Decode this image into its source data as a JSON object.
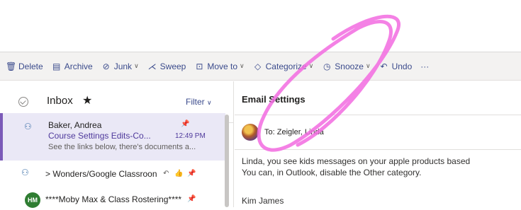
{
  "toolbar": {
    "delete": "Delete",
    "archive": "Archive",
    "junk": "Junk",
    "sweep": "Sweep",
    "move_to": "Move to",
    "categorize": "Categorize",
    "snooze": "Snooze",
    "undo": "Undo",
    "more": "···"
  },
  "list": {
    "folder": "Inbox",
    "star": "★",
    "filter": "Filter",
    "messages": [
      {
        "sender": "Baker, Andrea",
        "subject": "Course Settings Edits-Co...",
        "time": "12:49 PM",
        "preview": "See the links below, there's documents a..."
      },
      {
        "thread": "> Wonders/Google Classroon"
      },
      {
        "avatar": "HM",
        "thread": "****Moby Max & Class Rostering****"
      }
    ]
  },
  "reading": {
    "title": "Email Settings",
    "to": "To: Zeigler, Linda",
    "body_line1": "Linda, you see kids messages on your apple products based",
    "body_line2": "You can, in Outlook, disable the Other category.",
    "signature": "Kim James"
  },
  "colors": {
    "accent": "#3b4b8c",
    "selected_bg": "#eae8f6",
    "annotation": "#f26be0"
  },
  "icons": [
    "trash-icon",
    "archive-icon",
    "junk-icon",
    "sweep-icon",
    "move-icon",
    "tag-icon",
    "clock-icon",
    "undo-icon",
    "check-circle-icon",
    "pin-icon",
    "reply-icon",
    "like-icon",
    "group-avatar-icon"
  ]
}
